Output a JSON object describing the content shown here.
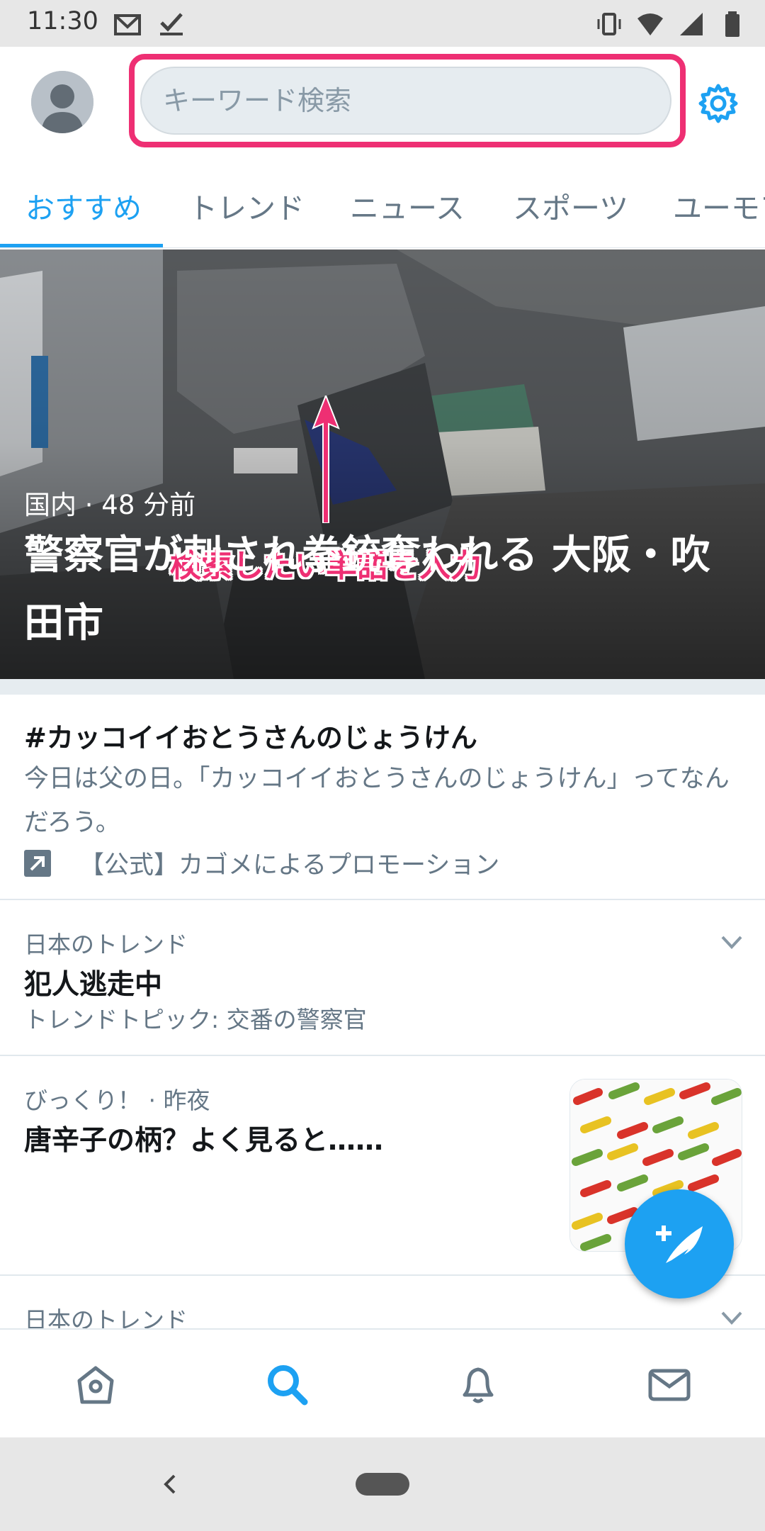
{
  "status_bar": {
    "time": "11:30"
  },
  "search": {
    "placeholder": "キーワード検索"
  },
  "tabs": [
    {
      "label": "おすすめ",
      "active": true
    },
    {
      "label": "トレンド",
      "active": false
    },
    {
      "label": "ニュース",
      "active": false
    },
    {
      "label": "スポーツ",
      "active": false
    },
    {
      "label": "ユーモア",
      "active": false
    }
  ],
  "annotation": {
    "text": "検索したい単語を入力",
    "color": "#ee2f73"
  },
  "hero": {
    "meta": "国内 · 48 分前",
    "title": "警察官が刺され拳銃奪われる 大阪・吹田市"
  },
  "promo": {
    "title": "#カッコイイおとうさんのじょうけん",
    "description": "今日は父の日。「カッコイイおとうさんのじょうけん」ってなんだろう。",
    "promoted_by": "【公式】カゴメによるプロモーション"
  },
  "trend1": {
    "label": "日本のトレンド",
    "title": "犯人逃走中",
    "subtitle": "トレンドトピック: 交番の警察官"
  },
  "news": {
    "meta": "びっくり！ · 昨夜",
    "title": "唐辛子の柄？よく見ると……"
  },
  "trend2": {
    "label": "日本のトレンド"
  },
  "colors": {
    "accent": "#1da1f2",
    "secondary_text": "#657786"
  },
  "icons": {
    "home": "home-icon",
    "search": "search-icon",
    "notifications": "bell-icon",
    "messages": "mail-icon",
    "settings": "gear-icon",
    "compose": "compose-tweet-icon"
  }
}
